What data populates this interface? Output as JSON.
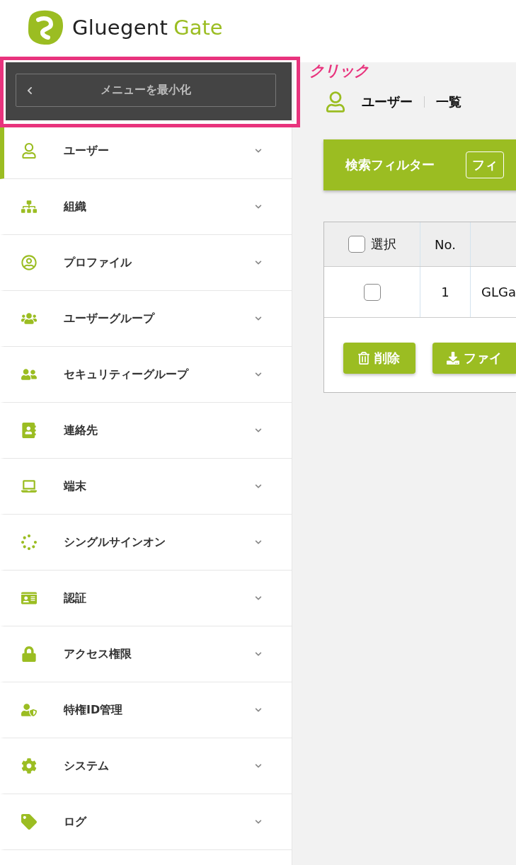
{
  "logo": {
    "name": "Gluegent",
    "product": "Gate"
  },
  "collapse_button": {
    "label": "メニューを最小化"
  },
  "annotation": {
    "label": "クリック"
  },
  "sidebar": {
    "items": [
      {
        "label": "ユーザー",
        "selected": true
      },
      {
        "label": "組織",
        "selected": false
      },
      {
        "label": "プロファイル",
        "selected": false
      },
      {
        "label": "ユーザーグループ",
        "selected": false
      },
      {
        "label": "セキュリティーグループ",
        "selected": false
      },
      {
        "label": "連絡先",
        "selected": false
      },
      {
        "label": "端末",
        "selected": false
      },
      {
        "label": "シングルサインオン",
        "selected": false
      },
      {
        "label": "認証",
        "selected": false
      },
      {
        "label": "アクセス権限",
        "selected": false
      },
      {
        "label": "特権ID管理",
        "selected": false
      },
      {
        "label": "システム",
        "selected": false
      },
      {
        "label": "ログ",
        "selected": false
      }
    ]
  },
  "breadcrumb": [
    "ユーザー",
    "一覧"
  ],
  "filter_bar": {
    "title": "検索フィルター",
    "button": "フィ"
  },
  "table": {
    "columns": [
      {
        "label": "選択",
        "kind": "checkbox"
      },
      {
        "label": "No.",
        "kind": "text"
      }
    ],
    "rows": [
      {
        "checked": false,
        "no": "1",
        "column_3": "GLGa"
      }
    ]
  },
  "header_checked": false,
  "buttons": [
    "削除",
    "ファイ"
  ]
}
